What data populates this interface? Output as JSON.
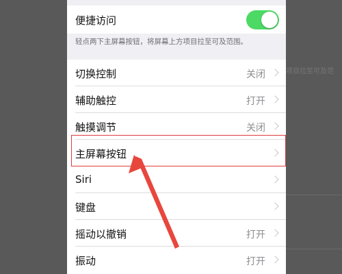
{
  "background": {
    "right_text": "项目拉至可及范"
  },
  "reachability": {
    "label": "便捷访问",
    "enabled": true,
    "note": "轻点两下主屏幕按钮，将屏幕上方项目拉至可及范围。"
  },
  "rows": [
    {
      "label": "切换控制",
      "value": "关闭"
    },
    {
      "label": "辅助触控",
      "value": "打开"
    },
    {
      "label": "触摸调节",
      "value": "关闭"
    },
    {
      "label": "主屏幕按钮",
      "value": ""
    },
    {
      "label": "Siri",
      "value": ""
    },
    {
      "label": "键盘",
      "value": ""
    },
    {
      "label": "摇动以撤销",
      "value": "打开"
    },
    {
      "label": "振动",
      "value": "打开"
    }
  ],
  "colors": {
    "toggle_on": "#4cd964",
    "highlight": "#e03a3a",
    "arrow": "#e8473d"
  }
}
